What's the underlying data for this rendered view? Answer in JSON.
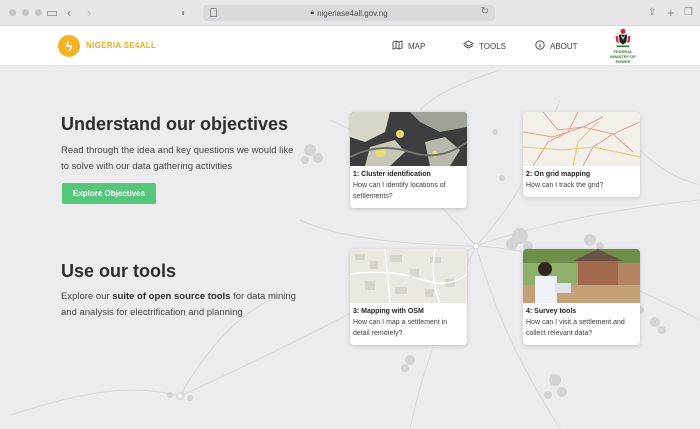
{
  "browser": {
    "url": "nigeriase4all.gov.ng"
  },
  "header": {
    "brand": "NIGERIA SE4ALL",
    "nav": [
      {
        "label": "MAP",
        "icon": "map-icon"
      },
      {
        "label": "TOOLS",
        "icon": "layers-icon"
      },
      {
        "label": "ABOUT",
        "icon": "info-icon"
      }
    ],
    "ministry_label": "FEDERAL MINISTRY OF POWER"
  },
  "hero": {
    "objectives_title": "Understand our objectives",
    "objectives_text": "Read through the idea and key questions we would like to solve with our data gathering activities",
    "objectives_button": "Explore Objectives",
    "tools_title": "Use our tools",
    "tools_text_pre": "Explore our ",
    "tools_text_bold": "suite of open source tools",
    "tools_text_post": " for data mining and analysis for electrification and planning"
  },
  "cards": [
    {
      "title": "1: Cluster identification",
      "desc": "How can I identify locations of settlements?"
    },
    {
      "title": "2: On grid mapping",
      "desc": "How can I track the grid?"
    },
    {
      "title": "3: Mapping with OSM",
      "desc": "How can I map a settlement in detail remotely?"
    },
    {
      "title": "4: Survey tools",
      "desc": "How can I visit a settlement and collect relevant data?"
    }
  ],
  "colors": {
    "accent": "#f4b324",
    "button": "#54c77a",
    "background": "#ececee"
  }
}
